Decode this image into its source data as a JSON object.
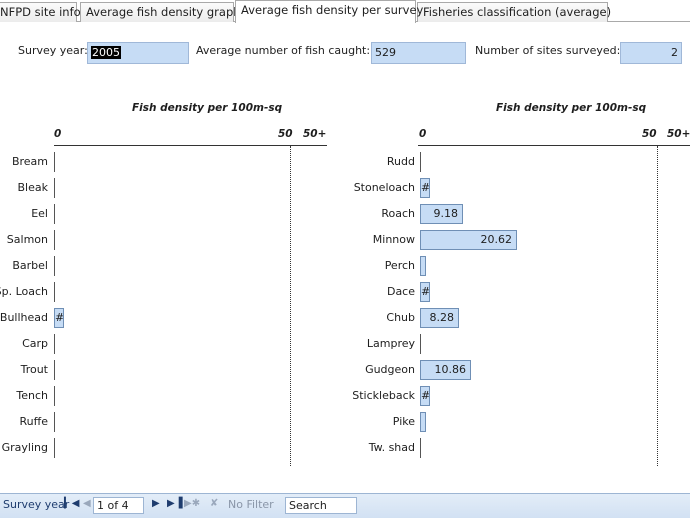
{
  "tabs": [
    {
      "label": "NFPD site info"
    },
    {
      "label": "Average fish density graph"
    },
    {
      "label": "Average fish density per survey"
    },
    {
      "label": "Fisheries classification (average)"
    }
  ],
  "header": {
    "survey_year_label": "Survey year:",
    "survey_year_value": "2005",
    "avg_fish_label": "Average number of fish caught:",
    "avg_fish_value": "529",
    "sites_label": "Number of sites surveyed:",
    "sites_value": "2"
  },
  "charts": [
    {
      "title": "Fish density per 100m-sq",
      "tick_0": "0",
      "tick_50": "50",
      "tick_50plus": "50+",
      "rows": [
        {
          "name": "Bream",
          "value": 0,
          "label": ""
        },
        {
          "name": "Bleak",
          "value": 0,
          "label": ""
        },
        {
          "name": "Eel",
          "value": 0,
          "label": ""
        },
        {
          "name": "Salmon",
          "value": 0,
          "label": ""
        },
        {
          "name": "Barbel",
          "value": 0,
          "label": ""
        },
        {
          "name": "Sp. Loach",
          "value": 0,
          "label": ""
        },
        {
          "name": "Bullhead",
          "value": 1.2,
          "label": "#"
        },
        {
          "name": "Carp",
          "value": 0,
          "label": ""
        },
        {
          "name": "Trout",
          "value": 0,
          "label": ""
        },
        {
          "name": "Tench",
          "value": 0,
          "label": ""
        },
        {
          "name": "Ruffe",
          "value": 0,
          "label": ""
        },
        {
          "name": "Grayling",
          "value": 0,
          "label": ""
        }
      ]
    },
    {
      "title": "Fish density per 100m-sq",
      "tick_0": "0",
      "tick_50": "50",
      "tick_50plus": "50+",
      "rows": [
        {
          "name": "Rudd",
          "value": 0,
          "label": ""
        },
        {
          "name": "Stoneloach",
          "value": 1.2,
          "label": "#"
        },
        {
          "name": "Roach",
          "value": 9.18,
          "label": "9.18"
        },
        {
          "name": "Minnow",
          "value": 20.62,
          "label": "20.62"
        },
        {
          "name": "Perch",
          "value": 0.2,
          "label": ""
        },
        {
          "name": "Dace",
          "value": 0.6,
          "label": "#"
        },
        {
          "name": "Chub",
          "value": 8.28,
          "label": "8.28"
        },
        {
          "name": "Lamprey",
          "value": 0,
          "label": ""
        },
        {
          "name": "Gudgeon",
          "value": 10.86,
          "label": "10.86"
        },
        {
          "name": "Stickleback",
          "value": 1.2,
          "label": "#"
        },
        {
          "name": "Pike",
          "value": 0.2,
          "label": ""
        },
        {
          "name": "Tw. shad",
          "value": 0,
          "label": ""
        }
      ]
    }
  ],
  "statusbar": {
    "record_label": "Survey year",
    "record_position": "1 of 4",
    "filter_label": "No Filter",
    "search_label": "Search",
    "first_icon": "first-record-icon",
    "prev_icon": "previous-record-icon",
    "next_icon": "next-record-icon",
    "last_icon": "last-record-icon",
    "new_icon": "new-record-icon",
    "filter_icon": "no-filter-icon"
  },
  "colors": {
    "field_fill": "#c6dcf5",
    "bar_fill": "#c6dcf5",
    "bar_border": "#6f8fb5",
    "status_bg": "#d2e1f3"
  }
}
